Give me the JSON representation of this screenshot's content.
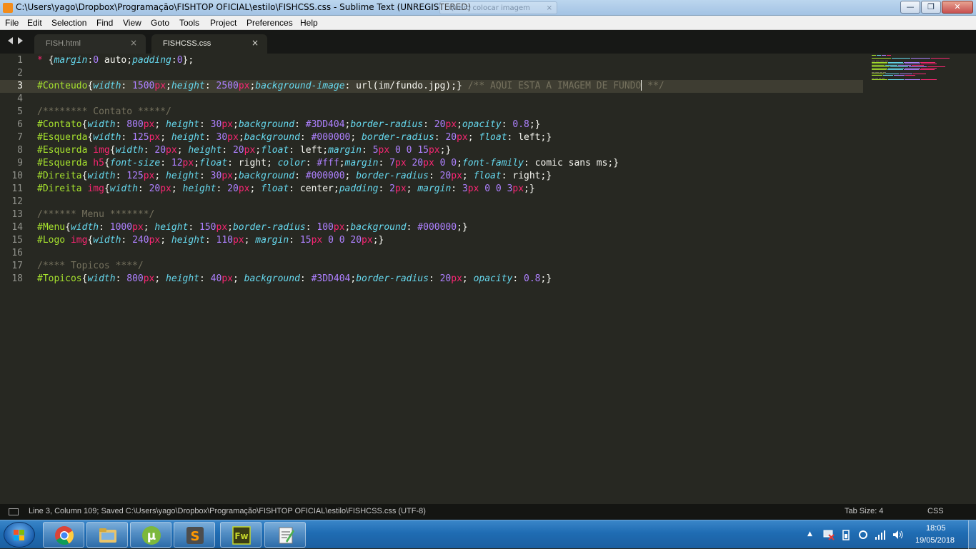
{
  "window": {
    "title": "C:\\Users\\yago\\Dropbox\\Programação\\FISHTOP OFICIAL\\estilo\\FISHCSS.css - Sublime Text (UNREGISTERED)",
    "background_tab_text": "Quero colocar imagem",
    "background_tab_close": "×",
    "minimize": "—",
    "maximize": "❐",
    "close": "✕"
  },
  "menu": {
    "items": [
      "File",
      "Edit",
      "Selection",
      "Find",
      "View",
      "Goto",
      "Tools",
      "Project",
      "Preferences",
      "Help"
    ]
  },
  "tabs": [
    {
      "label": "FISH.html",
      "close": "×",
      "active": false
    },
    {
      "label": "FISHCSS.css",
      "close": "×",
      "active": true
    }
  ],
  "editor": {
    "line_numbers": [
      "1",
      "2",
      "3",
      "4",
      "5",
      "6",
      "7",
      "8",
      "9",
      "10",
      "11",
      "12",
      "13",
      "14",
      "15",
      "16",
      "17",
      "18"
    ],
    "current_line": 3,
    "lines": [
      "* {margin:0 auto;padding:0};",
      "",
      "#Conteudo{width: 1500px;height: 2500px;background-image: url(im/fundo.jpg);} /** AQUI ESTA A IMAGEM DE FUNDO **/",
      "",
      "/******** Contato *****/",
      "#Contato{width: 800px; height: 30px;background: #3DD404;border-radius: 20px;opacity: 0.8;}",
      "#Esquerda{width: 125px; height: 30px;background: #000000; border-radius: 20px; float: left;}",
      "#Esquerda img{width: 20px; height: 20px;float: left;margin: 5px 0 0 15px;}",
      "#Esquerda h5{font-size: 12px;float: right; color: #fff;margin: 7px 20px 0 0;font-family: comic sans ms;}",
      "#Direita{width: 125px; height: 30px;background: #000000; border-radius: 20px; float: right;}",
      "#Direita img{width: 20px; height: 20px; float: center;padding: 2px; margin: 3px 0 0 3px;}",
      "",
      "/****** Menu *******/",
      "#Menu{width: 1000px; height: 150px;border-radius: 100px;background: #000000;}",
      "#Logo img{width: 240px; height: 110px; margin: 15px 0 0 20px;}",
      "",
      "/**** Topicos ****/",
      "#Topicos{width: 800px; height: 40px; background: #3DD404;border-radius: 20px; opacity: 0.8;}"
    ]
  },
  "status": {
    "text": "Line 3, Column 109; Saved C:\\Users\\yago\\Dropbox\\Programação\\FISHTOP OFICIAL\\estilo\\FISHCSS.css (UTF-8)",
    "tab_size": "Tab Size: 4",
    "syntax": "CSS"
  },
  "taskbar": {
    "apps": [
      "chrome-icon",
      "file-explorer-icon",
      "utorrent-icon",
      "sublime-text-icon",
      "fireworks-icon",
      "notepad-icon"
    ],
    "fireworks_label": "Fw",
    "utorrent_label": "µ",
    "sublime_label": "S",
    "tray_arrow": "▲",
    "time": "18:05",
    "date": "19/05/2018"
  },
  "colors": {
    "editor_bg": "#272822",
    "keyword": "#f92672",
    "property": "#66d9ef",
    "number": "#ae81ff",
    "selector": "#a6e22e",
    "comment": "#75715e",
    "string": "#e6db74"
  }
}
